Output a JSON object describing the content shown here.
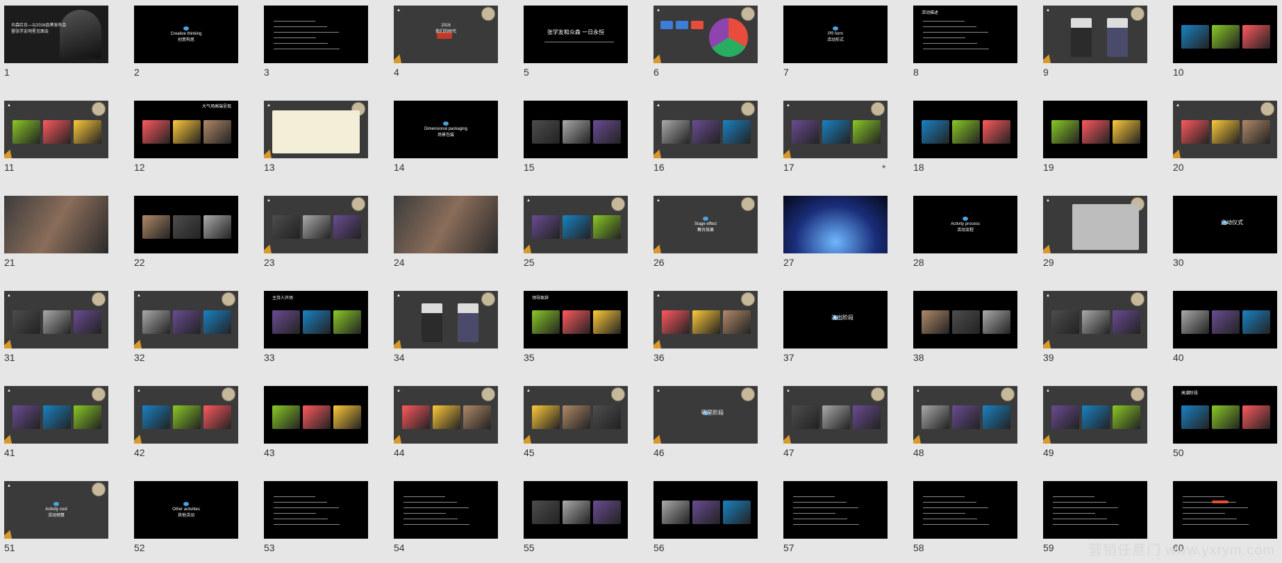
{
  "slides": [
    {
      "n": "1",
      "bg": "photo",
      "style": "cover",
      "text": [
        "众森红日—以2016品牌发布会",
        "暨张学友明星见面会"
      ]
    },
    {
      "n": "2",
      "bg": "black",
      "style": "center",
      "text": [
        "Creative thinking",
        "创意构思"
      ]
    },
    {
      "n": "3",
      "bg": "black",
      "style": "para",
      "text": []
    },
    {
      "n": "4",
      "bg": "gray",
      "style": "year",
      "text": [
        "2016",
        "我们的时代"
      ]
    },
    {
      "n": "5",
      "bg": "black",
      "style": "quote",
      "text": [
        "张学友和众森 一日永恒"
      ]
    },
    {
      "n": "6",
      "bg": "gray",
      "style": "pie",
      "text": []
    },
    {
      "n": "7",
      "bg": "black",
      "style": "center",
      "text": [
        "PR form",
        "活动形式"
      ]
    },
    {
      "n": "8",
      "bg": "black",
      "style": "list",
      "text": [
        "活动描述"
      ]
    },
    {
      "n": "9",
      "bg": "gray",
      "style": "people",
      "text": []
    },
    {
      "n": "10",
      "bg": "black",
      "style": "image-right",
      "text": []
    },
    {
      "n": "11",
      "bg": "gray",
      "style": "photos",
      "text": []
    },
    {
      "n": "12",
      "bg": "black",
      "style": "stage",
      "text": [
        "大气场高端呈现"
      ]
    },
    {
      "n": "13",
      "bg": "gray",
      "style": "plan",
      "text": []
    },
    {
      "n": "14",
      "bg": "black",
      "style": "center",
      "text": [
        "Dimensional packaging",
        "场景包装"
      ]
    },
    {
      "n": "15",
      "bg": "black",
      "style": "balloons",
      "text": []
    },
    {
      "n": "16",
      "bg": "gray",
      "style": "photos",
      "text": []
    },
    {
      "n": "17",
      "bg": "gray",
      "style": "photos",
      "text": [],
      "star": true
    },
    {
      "n": "18",
      "bg": "black",
      "style": "photos",
      "text": []
    },
    {
      "n": "19",
      "bg": "black",
      "style": "photos",
      "text": []
    },
    {
      "n": "20",
      "bg": "gray",
      "style": "photos",
      "text": []
    },
    {
      "n": "21",
      "bg": "photo",
      "style": "full",
      "text": []
    },
    {
      "n": "22",
      "bg": "black",
      "style": "photos",
      "text": []
    },
    {
      "n": "23",
      "bg": "gray",
      "style": "photos",
      "text": []
    },
    {
      "n": "24",
      "bg": "photo",
      "style": "full",
      "text": []
    },
    {
      "n": "25",
      "bg": "gray",
      "style": "photos",
      "text": []
    },
    {
      "n": "26",
      "bg": "gray",
      "style": "center",
      "text": [
        "Stage effect",
        "舞台效果"
      ]
    },
    {
      "n": "27",
      "bg": "photo",
      "style": "stage-blue",
      "text": []
    },
    {
      "n": "28",
      "bg": "black",
      "style": "center",
      "text": [
        "Activity process",
        "活动流程"
      ]
    },
    {
      "n": "29",
      "bg": "gray",
      "style": "table",
      "text": []
    },
    {
      "n": "30",
      "bg": "black",
      "style": "center-big",
      "text": [
        "启动仪式"
      ]
    },
    {
      "n": "31",
      "bg": "gray",
      "style": "photos",
      "text": []
    },
    {
      "n": "32",
      "bg": "gray",
      "style": "photos",
      "text": []
    },
    {
      "n": "33",
      "bg": "black",
      "style": "photos",
      "text": [
        "主持人开场"
      ]
    },
    {
      "n": "34",
      "bg": "gray",
      "style": "people",
      "text": []
    },
    {
      "n": "35",
      "bg": "black",
      "style": "photos",
      "text": [
        "领导致辞"
      ]
    },
    {
      "n": "36",
      "bg": "gray",
      "style": "photos",
      "text": []
    },
    {
      "n": "37",
      "bg": "black",
      "style": "center-big",
      "text": [
        "演出阶段"
      ]
    },
    {
      "n": "38",
      "bg": "black",
      "style": "photos",
      "text": []
    },
    {
      "n": "39",
      "bg": "gray",
      "style": "photos",
      "text": []
    },
    {
      "n": "40",
      "bg": "black",
      "style": "photos",
      "text": []
    },
    {
      "n": "41",
      "bg": "gray",
      "style": "photos",
      "text": []
    },
    {
      "n": "42",
      "bg": "gray",
      "style": "photos",
      "text": []
    },
    {
      "n": "43",
      "bg": "black",
      "style": "photos",
      "text": []
    },
    {
      "n": "44",
      "bg": "gray",
      "style": "photos",
      "text": []
    },
    {
      "n": "45",
      "bg": "gray",
      "style": "photos",
      "text": []
    },
    {
      "n": "46",
      "bg": "gray",
      "style": "center-big",
      "text": [
        "明星阶段"
      ]
    },
    {
      "n": "47",
      "bg": "gray",
      "style": "photos",
      "text": []
    },
    {
      "n": "48",
      "bg": "gray",
      "style": "photos",
      "text": []
    },
    {
      "n": "49",
      "bg": "gray",
      "style": "photos",
      "text": []
    },
    {
      "n": "50",
      "bg": "black",
      "style": "photos",
      "text": [
        "高潮阶段"
      ]
    },
    {
      "n": "51",
      "bg": "gray",
      "style": "center",
      "text": [
        "Activity cost",
        "活动预算"
      ]
    },
    {
      "n": "52",
      "bg": "black",
      "style": "center",
      "text": [
        "Other activities",
        "其他活动"
      ]
    },
    {
      "n": "53",
      "bg": "black",
      "style": "list",
      "text": []
    },
    {
      "n": "54",
      "bg": "black",
      "style": "list",
      "text": []
    },
    {
      "n": "55",
      "bg": "black",
      "style": "photos",
      "text": []
    },
    {
      "n": "56",
      "bg": "black",
      "style": "photos",
      "text": []
    },
    {
      "n": "57",
      "bg": "black",
      "style": "list",
      "text": []
    },
    {
      "n": "58",
      "bg": "black",
      "style": "list",
      "text": []
    },
    {
      "n": "59",
      "bg": "black",
      "style": "list",
      "text": []
    },
    {
      "n": "60",
      "bg": "black",
      "style": "list-red",
      "text": []
    }
  ],
  "watermark": "营销任意门 www.yxrym.com"
}
